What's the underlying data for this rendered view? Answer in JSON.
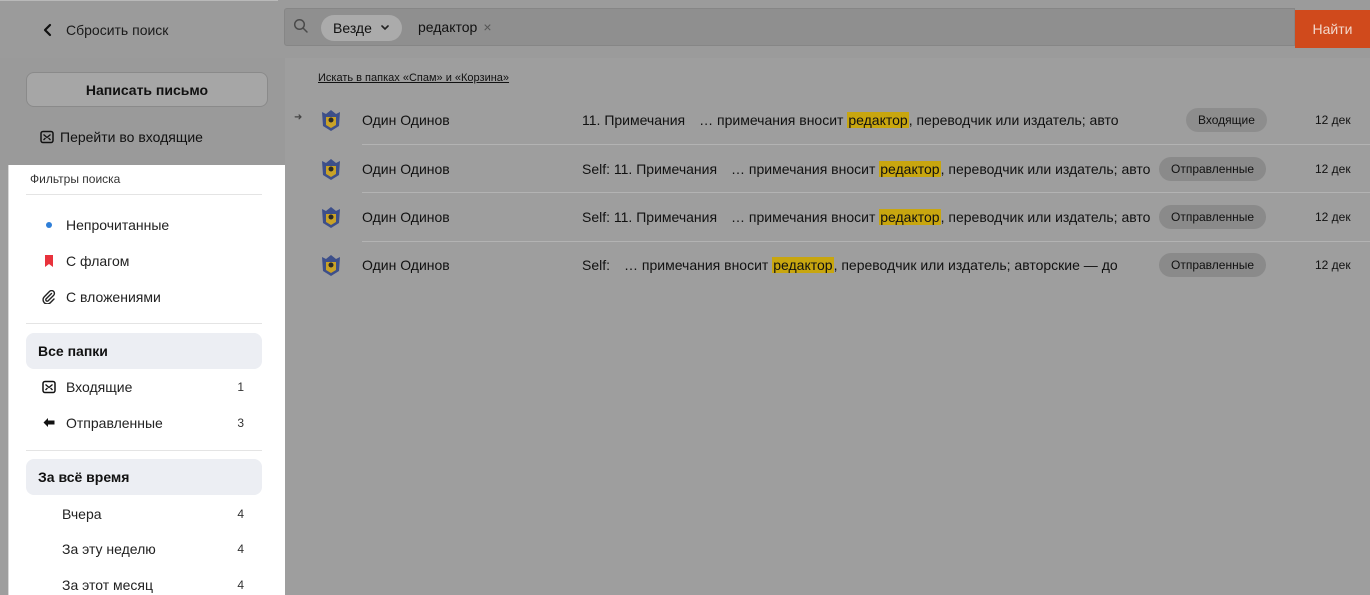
{
  "topbar": {
    "back_label": "Сбросить поиск",
    "scope_label": "Везде",
    "query": "редактор",
    "clear_symbol": "×",
    "find_label": "Найти"
  },
  "sidebar": {
    "compose_label": "Написать письмо",
    "goto_inbox_label": "Перейти во входящие",
    "filters_title": "Фильтры поиска",
    "filters": [
      {
        "label": "Непрочитанные",
        "icon": "unread-dot-icon"
      },
      {
        "label": "С флагом",
        "icon": "flag-icon"
      },
      {
        "label": "С вложениями",
        "icon": "paperclip-icon"
      }
    ],
    "folders_header": "Все папки",
    "folders": [
      {
        "label": "Входящие",
        "count": "1",
        "icon": "inbox-icon"
      },
      {
        "label": "Отправленные",
        "count": "3",
        "icon": "sent-icon"
      }
    ],
    "time_header": "За всё время",
    "time_ranges": [
      {
        "label": "Вчера",
        "count": "4"
      },
      {
        "label": "За эту неделю",
        "count": "4"
      },
      {
        "label": "За этот месяц",
        "count": "4"
      }
    ]
  },
  "main": {
    "spam_link": "Искать в папках «Спам» и «Корзина»",
    "messages": [
      {
        "sender": "Один Одинов",
        "subject": "11. Примечания",
        "snippet_before": "… примечания вносит ",
        "highlight": "редактор",
        "snippet_after": ", переводчик или издатель; авто",
        "folder": "Входящие",
        "date": "12 дек",
        "has_arrow": true
      },
      {
        "sender": "Один Одинов",
        "subject": "Self: 11. Примечания",
        "snippet_before": "… примечания вносит ",
        "highlight": "редактор",
        "snippet_after": ", переводчик или издатель; авто",
        "folder": "Отправленные",
        "date": "12 дек",
        "has_arrow": false
      },
      {
        "sender": "Один Одинов",
        "subject": "Self: 11. Примечания",
        "snippet_before": "… примечания вносит ",
        "highlight": "редактор",
        "snippet_after": ", переводчик или издатель; авто",
        "folder": "Отправленные",
        "date": "12 дек",
        "has_arrow": false
      },
      {
        "sender": "Один Одинов",
        "subject": "Self:",
        "snippet_before": "… примечания вносит ",
        "highlight": "редактор",
        "snippet_after": ", переводчик или издатель; авторские — до",
        "folder": "Отправленные",
        "date": "12 дек",
        "has_arrow": false
      }
    ]
  },
  "colors": {
    "find_button": "#d04a1c",
    "highlight": "#c8a60f",
    "flag": "#e8323c",
    "unread_dot": "#2f7fd8"
  }
}
